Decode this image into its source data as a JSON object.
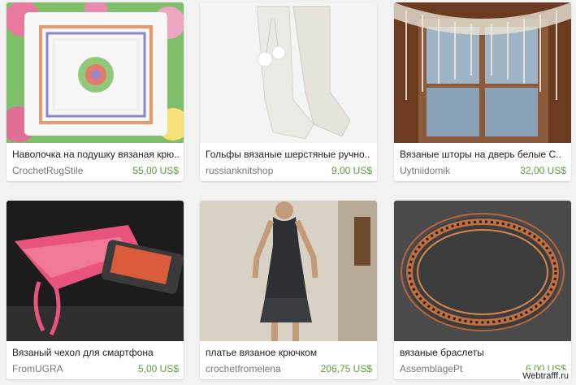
{
  "listings": [
    {
      "title": "Наволочка на подушку вязаная крю..",
      "shop": "CrochetRugStile",
      "price": "55,00 US$",
      "image_icon": "pillow-photo-icon"
    },
    {
      "title": "Гольфы вязаные шерстяные ручно..",
      "shop": "russianknitshop",
      "price": "9,00 US$",
      "image_icon": "socks-photo-icon"
    },
    {
      "title": "Вязаные шторы на дверь белые С..",
      "shop": "Uytniidomik",
      "price": "32,00 US$",
      "image_icon": "curtain-photo-icon"
    },
    {
      "title": "Вязаный чехол для смартфона",
      "shop": "FromUGRA",
      "price": "5,00 US$",
      "image_icon": "phone-case-photo-icon"
    },
    {
      "title": "платье вязаное крючком",
      "shop": "crochetfromelena",
      "price": "206,75 US$",
      "image_icon": "dress-photo-icon"
    },
    {
      "title": "вязаные браслеты",
      "shop": "AssemblagePt",
      "price": "6,00 US$",
      "image_icon": "bracelet-photo-icon"
    }
  ],
  "watermark": "Webtrafff.ru",
  "colors": {
    "price": "#5a9c3c",
    "shop": "#777777",
    "background": "#f2f2f2"
  }
}
